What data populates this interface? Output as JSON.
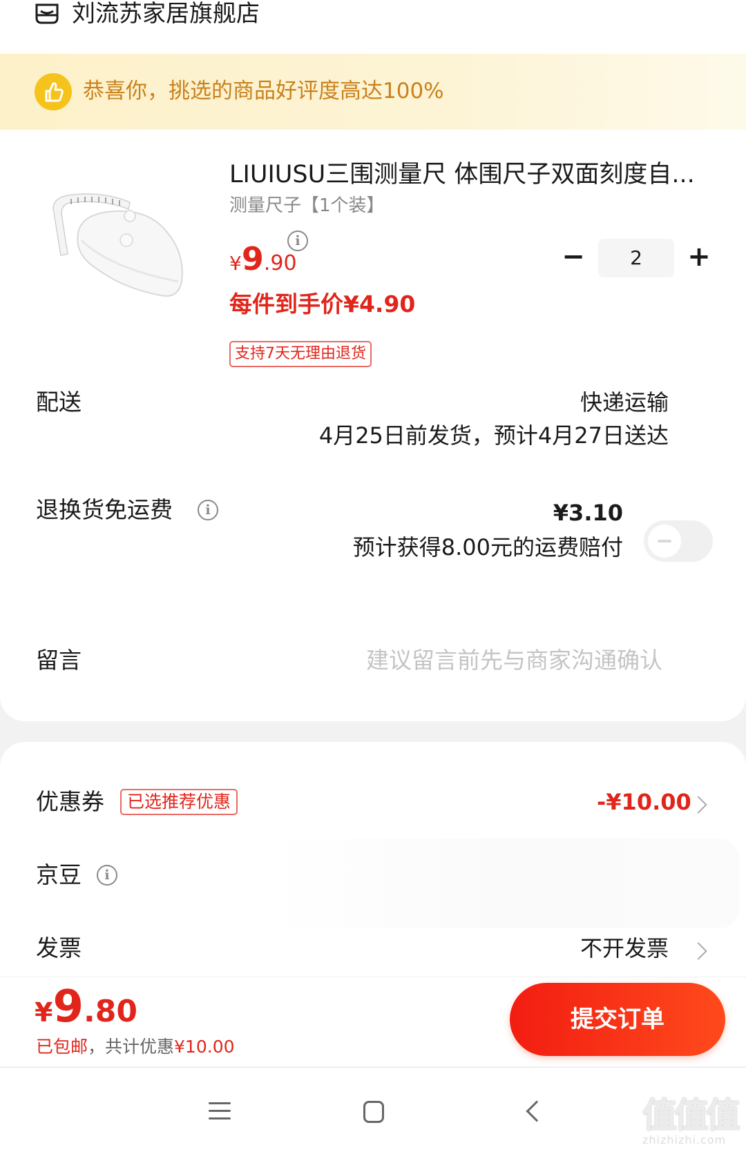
{
  "store": {
    "name": "刘流苏家居旗舰店",
    "icon": "store-icon"
  },
  "banner": {
    "text": "恭喜你，挑选的商品好评度高达100%",
    "icon": "thumbs-up-icon"
  },
  "product": {
    "title": "LIUIUSU三围测量尺 体围尺子双面刻度自...",
    "spec": "测量尺子【1个装】",
    "price_currency": "¥",
    "price_int": "9",
    "price_dec": ".90",
    "unit_price": "每件到手价¥4.90",
    "return_tag": "支持7天无理由退货",
    "quantity": "2",
    "minus_symbol": "−",
    "plus_symbol": "+"
  },
  "delivery": {
    "label": "配送",
    "method": "快递运输",
    "schedule": "4月25日前发货，预计4月27日送达"
  },
  "return_shipping": {
    "label": "退换货免运费",
    "price": "¥3.10",
    "note": "预计获得8.00元的运费赔付",
    "enabled": false
  },
  "message": {
    "label": "留言",
    "placeholder": "建议留言前先与商家沟通确认"
  },
  "coupon": {
    "label": "优惠券",
    "tag": "已选推荐优惠",
    "value": "-¥10.00"
  },
  "beans": {
    "label": "京豆"
  },
  "invoice": {
    "label": "发票",
    "value": "不开发票"
  },
  "footer": {
    "total_currency": "¥",
    "total_int": "9",
    "total_dec": ".80",
    "note_shipping": "已包邮",
    "note_discount": "，共计优惠",
    "note_amount": "¥10.00",
    "submit_label": "提交订单"
  },
  "watermark": {
    "big": "值值值",
    "small": "zhizhizhi.com"
  },
  "colors": {
    "accent": "#e1251b",
    "banner_text": "#c9811c",
    "banner_bg": "#fdf1c9"
  }
}
